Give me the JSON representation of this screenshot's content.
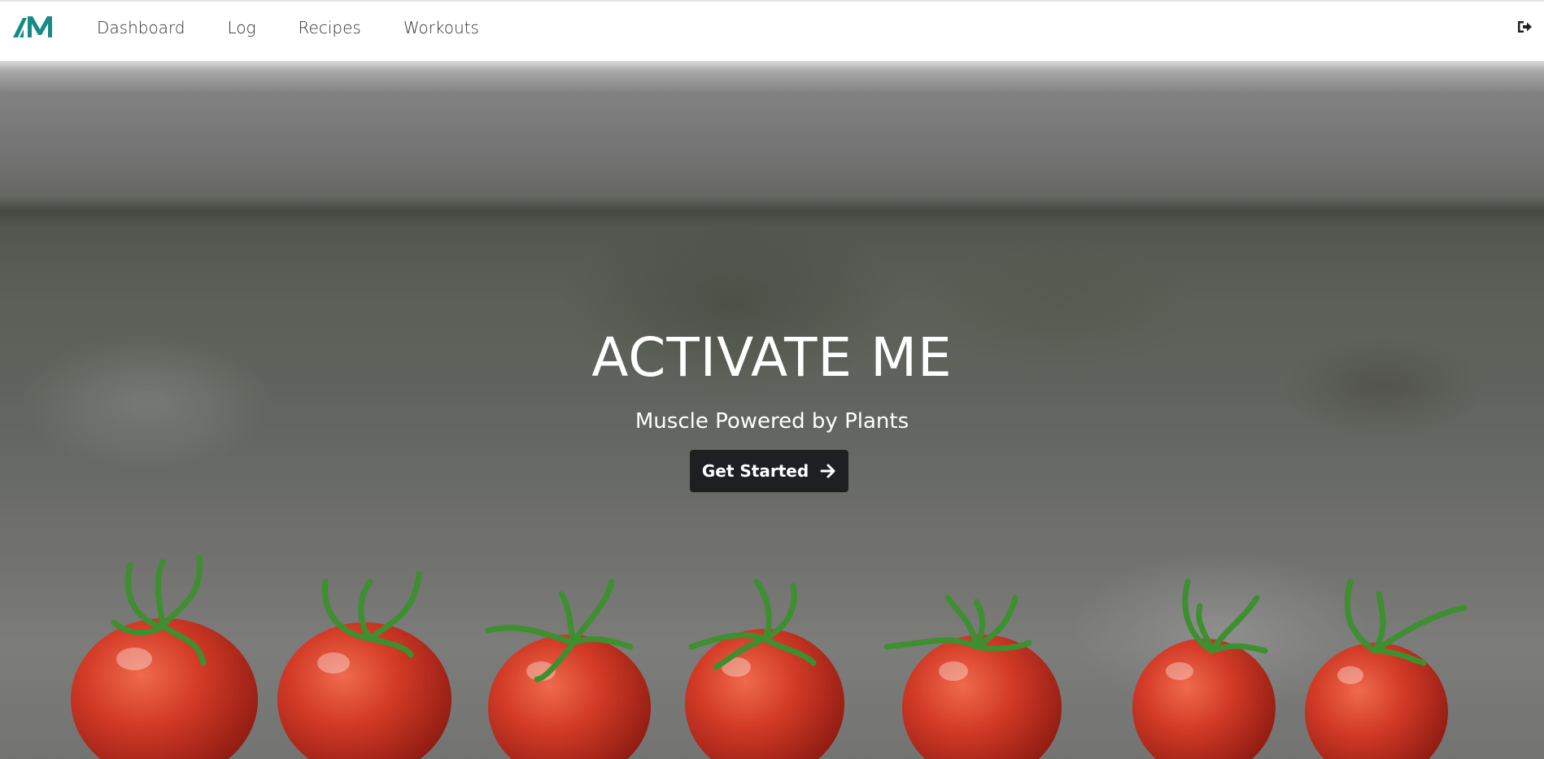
{
  "header": {
    "logo_text": "AM",
    "nav": [
      {
        "label": "Dashboard"
      },
      {
        "label": "Log"
      },
      {
        "label": "Recipes"
      },
      {
        "label": "Workouts"
      }
    ],
    "logout_icon": "sign-out-icon"
  },
  "hero": {
    "title": "ACTIVATE ME",
    "subtitle": "Muscle Powered by Plants",
    "cta_label": "Get Started",
    "cta_icon": "arrow-right-icon",
    "background_image": "cherry-tomatoes-on-stone-wall"
  },
  "colors": {
    "brand": "#1a8a87",
    "cta_bg": "#1e1f21",
    "nav_text": "#2f2f2f",
    "tomato": "#d23a26",
    "stem": "#3d8f2f"
  }
}
